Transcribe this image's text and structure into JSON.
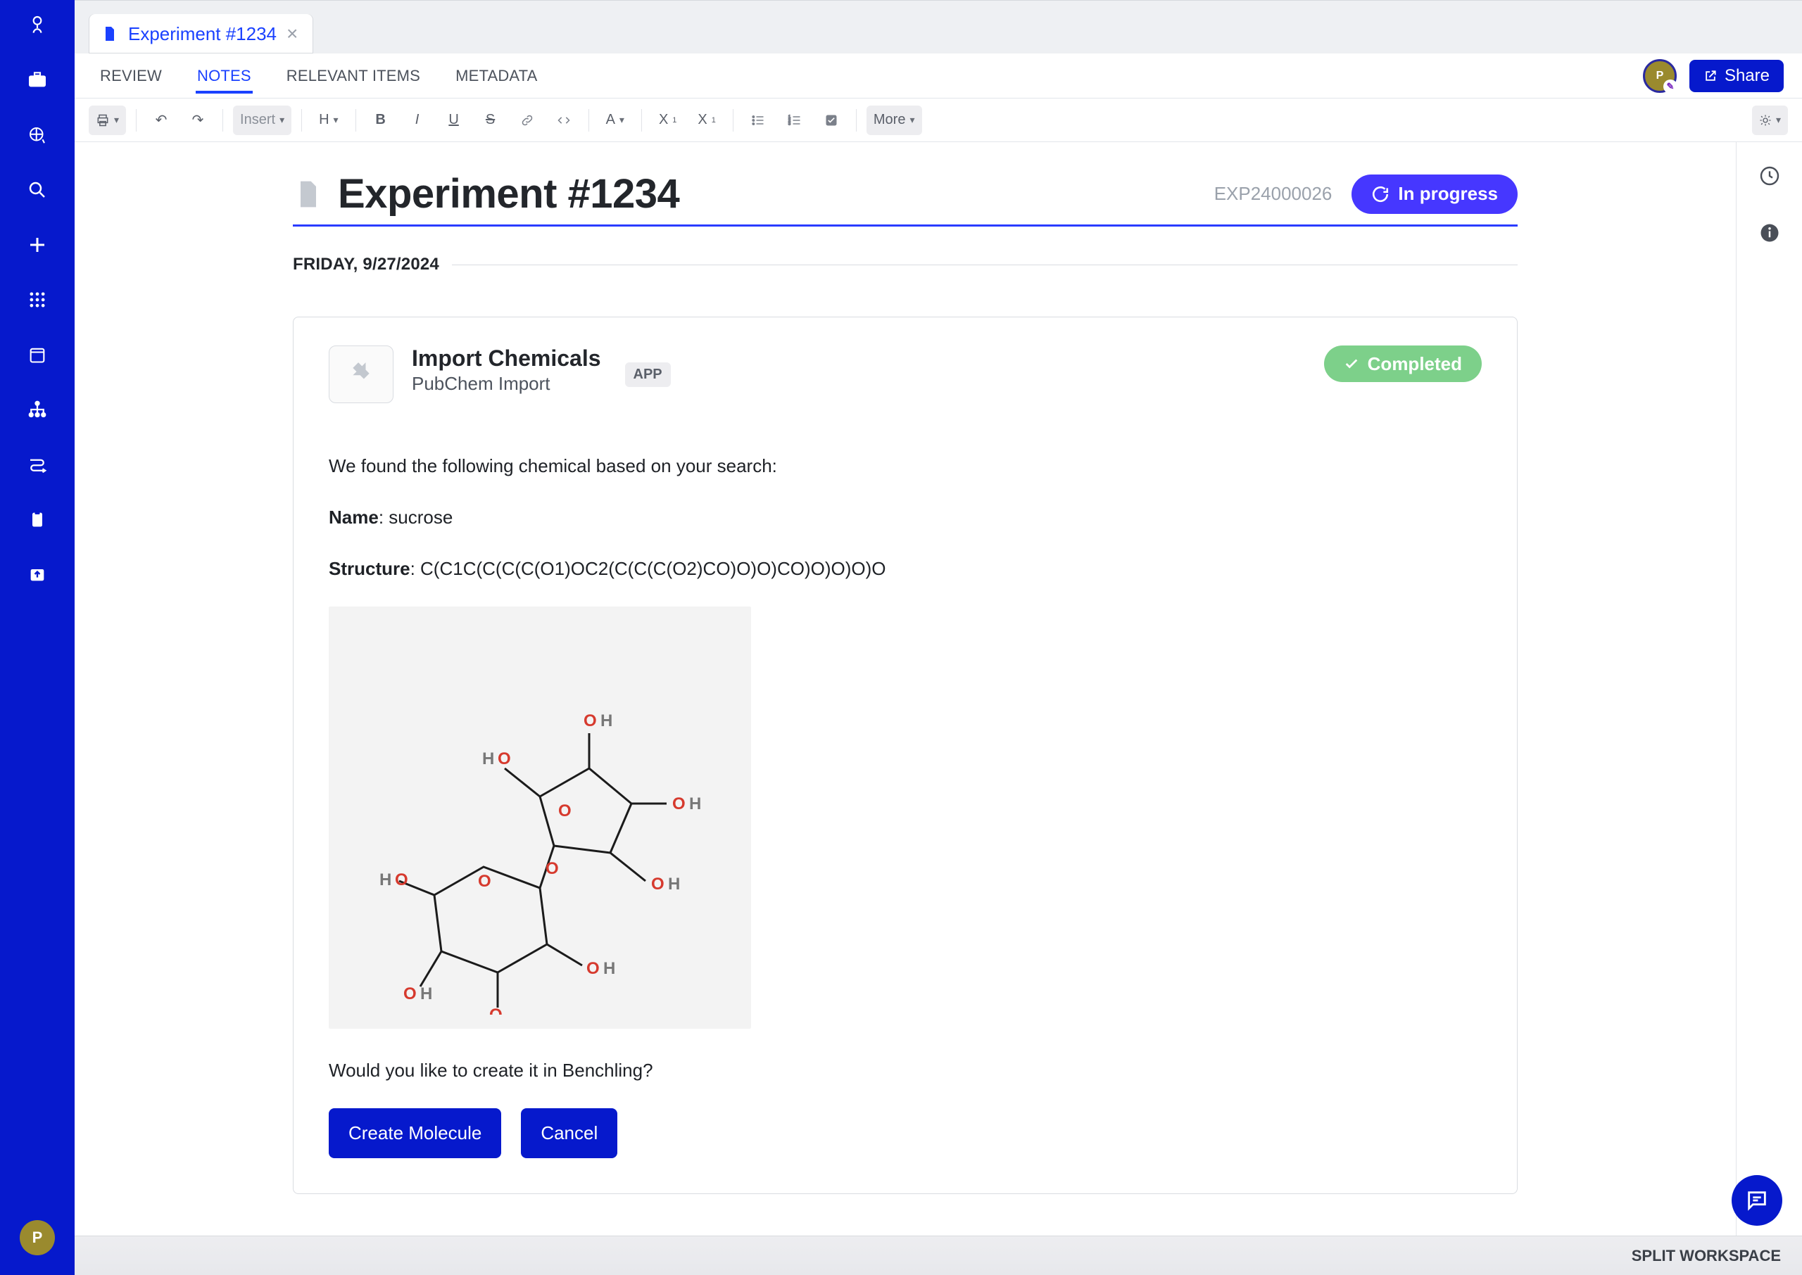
{
  "sidebar": {
    "avatar_initial": "P"
  },
  "tab": {
    "label": "Experiment #1234"
  },
  "subtabs": {
    "review": "REVIEW",
    "notes": "NOTES",
    "relevant": "RELEVANT ITEMS",
    "metadata": "METADATA"
  },
  "header": {
    "share_label": "Share",
    "avatar_initial": "P"
  },
  "toolbar": {
    "insert": "Insert",
    "h": "H",
    "a": "A",
    "more": "More"
  },
  "document": {
    "title": "Experiment #1234",
    "exp_id": "EXP24000026",
    "status": "In progress",
    "date": "FRIDAY, 9/27/2024"
  },
  "card": {
    "title": "Import Chemicals",
    "subtitle": "PubChem Import",
    "badge": "APP",
    "status": "Completed",
    "intro": "We found the following chemical based on your search:",
    "name_label": "Name",
    "name_value": ": sucrose",
    "structure_label": "Structure",
    "structure_value": ": C(C1C(C(C(C(O1)OC2(C(C(C(O2)CO)O)O)CO)O)O)O)O",
    "question": "Would you like to create it in Benchling?",
    "create": "Create Molecule",
    "cancel": "Cancel"
  },
  "footer": {
    "split": "SPLIT WORKSPACE"
  }
}
